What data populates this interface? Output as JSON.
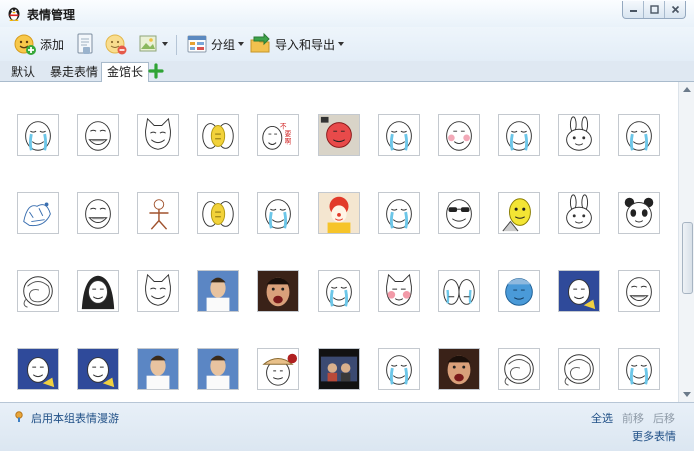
{
  "window": {
    "title": "表情管理",
    "controls": [
      "minimize-icon",
      "maximize-icon",
      "close-icon"
    ]
  },
  "toolbar": {
    "add_label": "添加",
    "group_label": "分组",
    "import_export_label": "导入和导出"
  },
  "tabs": [
    "默认",
    "暴走表情",
    "金馆长"
  ],
  "active_tab": "金馆长",
  "grid": {
    "columns": 11,
    "rows": [
      [
        "face-cry",
        "face-smile",
        "cat-smile",
        "double-yellow",
        "face-redtext",
        "face-red",
        "face-cry",
        "face-blush",
        "face-cry",
        "rabbit",
        "face-cry"
      ],
      [
        "bird-scribble",
        "face-smile",
        "stickman",
        "double-yellow",
        "face-cry",
        "clown",
        "face-cry",
        "face-glasses",
        "face-yellow",
        "rabbit",
        "panda"
      ],
      [
        "face-swirl",
        "face-dark",
        "cat-smile",
        "photo-person",
        "photo-face",
        "face-cry",
        "cat-blush",
        "double-cry",
        "face-blue",
        "face-photo-blue",
        "face-smile"
      ],
      [
        "face-photo-blue",
        "face-photo-blue",
        "photo-person",
        "photo-person",
        "face-hat",
        "photo-group",
        "face-cry",
        "photo-face",
        "face-swirl",
        "face-swirl",
        "face-cry"
      ]
    ]
  },
  "footer": {
    "roam_label": "启用本组表情漫游",
    "select_all": "全选",
    "move_forward": "前移",
    "move_back": "后移",
    "more": "更多表情"
  }
}
